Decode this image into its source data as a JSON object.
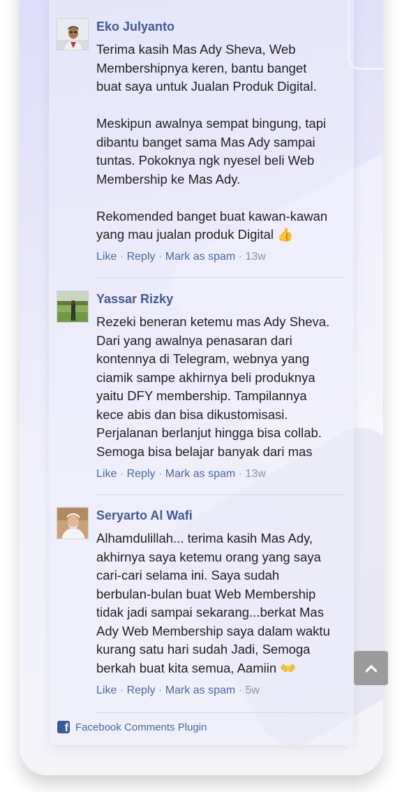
{
  "comments": [
    {
      "author": "Eko Julyanto",
      "lines": [
        "Terima kasih Mas Ady Sheva, Web",
        "Membershipnya keren, bantu banget",
        "buat saya untuk Jualan Produk Digital.",
        "",
        "Meskipun awalnya sempat bingung, tapi",
        "dibantu banget sama Mas Ady sampai",
        "tuntas. Pokoknya ngk nyesel beli Web",
        "Membership ke Mas Ady.",
        "",
        "Rekomended banget buat kawan-kawan",
        "yang mau jualan produk Digital 👍"
      ],
      "like": "Like",
      "reply": "Reply",
      "spam": "Mark as spam",
      "time": "13w"
    },
    {
      "author": "Yassar Rizky",
      "lines": [
        "Rezeki beneran ketemu mas Ady Sheva.",
        "Dari yang awalnya penasaran dari",
        "kontennya di Telegram, webnya yang",
        "ciamik sampe akhirnya beli produknya",
        "yaitu DFY membership. Tampilannya",
        "kece abis dan bisa dikustomisasi.",
        "Perjalanan berlanjut hingga bisa collab.",
        "Semoga bisa belajar banyak dari mas"
      ],
      "like": "Like",
      "reply": "Reply",
      "spam": "Mark as spam",
      "time": "13w"
    },
    {
      "author": "Seryarto Al Wafi",
      "lines": [
        "Alhamdulillah... terima kasih Mas Ady,",
        "akhirnya saya ketemu orang yang saya",
        "cari-cari selama ini. Saya sudah",
        "berbulan-bulan buat Web Membership",
        "tidak jadi sampai sekarang...berkat Mas",
        "Ady Web Membership saya dalam waktu",
        "kurang satu hari sudah Jadi, Semoga",
        "berkah buat kita semua, Aamiin 👐"
      ],
      "like": "Like",
      "reply": "Reply",
      "spam": "Mark as spam",
      "time": "5w"
    }
  ],
  "separator": "·",
  "plugin_label": "Facebook Comments Plugin",
  "colors": {
    "author": "#3f5a96",
    "link": "#4b67a1",
    "muted": "#90949c",
    "scroll_button": "#9b9b9b"
  },
  "icons": {
    "plugin": "facebook-icon",
    "scroll_top": "chevron-up-icon"
  }
}
